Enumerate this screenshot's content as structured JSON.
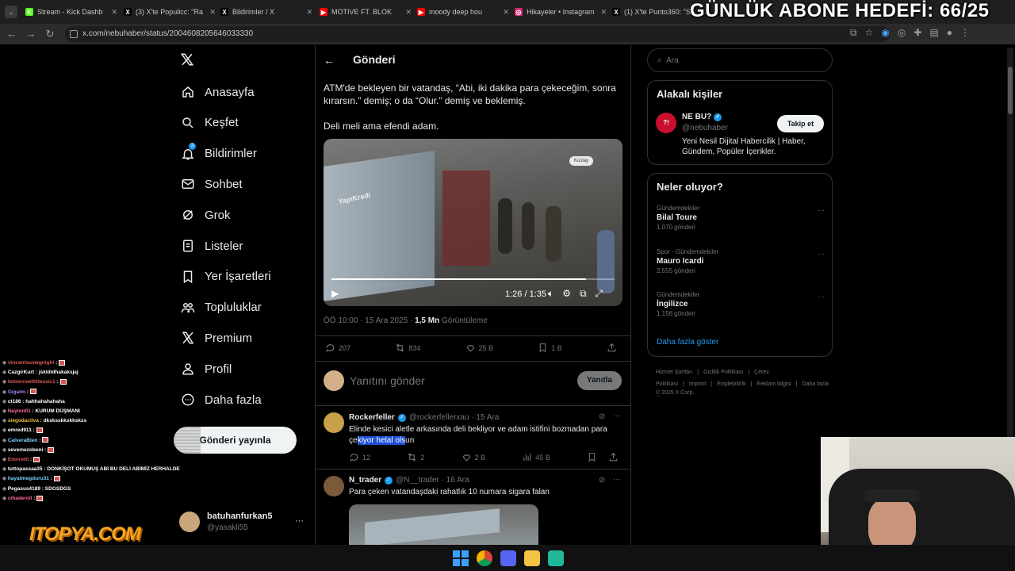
{
  "browser": {
    "tabs": [
      {
        "label": "Stream - Kick Dashb",
        "color": "#53fc18",
        "glyph": "K"
      },
      {
        "label": "(3) X'te Populicc: \"Ra",
        "color": "#000",
        "glyph": "X"
      },
      {
        "label": "Bildirimler / X",
        "color": "#000",
        "glyph": "X"
      },
      {
        "label": "MOTIVE FT. BLOK",
        "color": "#ff0000",
        "glyph": "▶"
      },
      {
        "label": "moody deep hou",
        "color": "#ff0000",
        "glyph": "▶"
      },
      {
        "label": "Hikayeler • Instagram",
        "color": "#d62976",
        "glyph": "◎"
      },
      {
        "label": "(1) X'te Punto360: \"S",
        "color": "#000",
        "glyph": "X"
      }
    ],
    "url": "x.com/nebuhaber/status/2004608205646033330"
  },
  "overlay": {
    "goal": "GÜNLÜK ABONE HEDEFİ: 66/25",
    "watermark": "ITOPYA.COM"
  },
  "nav": {
    "items": [
      {
        "label": "Anasayfa",
        "icon": "home-icon"
      },
      {
        "label": "Keşfet",
        "icon": "search-icon"
      },
      {
        "label": "Bildirimler",
        "icon": "bell-icon",
        "badge": "3"
      },
      {
        "label": "Sohbet",
        "icon": "mail-icon"
      },
      {
        "label": "Grok",
        "icon": "grok-icon"
      },
      {
        "label": "Listeler",
        "icon": "list-icon"
      },
      {
        "label": "Yer İşaretleri",
        "icon": "bookmark-icon"
      },
      {
        "label": "Topluluklar",
        "icon": "communities-icon"
      },
      {
        "label": "Premium",
        "icon": "x-logo-icon"
      },
      {
        "label": "Profil",
        "icon": "profile-icon"
      },
      {
        "label": "Daha fazla",
        "icon": "more-circle-icon"
      }
    ],
    "post_button": "Gönderi yayınla",
    "account_name": "batuhanfurkan5",
    "account_handle": "@yasakli55"
  },
  "post": {
    "header": "Gönderi",
    "text1": "ATM'de bekleyen bir vatandaş, “Abi, iki dakika para çekeceğim, sonra kırarsın.” demiş; o da “Olur.” demiş ve beklemiş.",
    "text2": "Deli meli ama efendi adam.",
    "video_time": "1:26 / 1:35",
    "video_progress": 0.9,
    "meta_time": "ÖÖ 10:00 · 15 Ara 2025 · ",
    "views": "1,5 Mn",
    "views_label": "Görüntüleme",
    "stats": {
      "replies": "207",
      "reposts": "834",
      "likes": "25 B",
      "bookmarks": "1 B"
    },
    "reply_placeholder": "Yanıtını gönder",
    "reply_button": "Yanıtla"
  },
  "replies": [
    {
      "name": "Rockerfeller",
      "handle": "@rockerfellerxau · 15 Ara",
      "text_before": "Elinde kesici aletle arkasında deli bekliyor ve adam istifini bozmadan para çe",
      "text_selected": "kiyor helal ols",
      "text_after": "un",
      "replies": "12",
      "reposts": "2",
      "likes": "2 B",
      "views": "45 B"
    },
    {
      "name": "N_trader",
      "handle": "@N__trader · 16 Ara",
      "text": "Para çeken vatandaşdaki rahatlık 10 numara sigara falan"
    }
  ],
  "search": {
    "placeholder": "Ara"
  },
  "related": {
    "title": "Alakalı kişiler",
    "name": "NE BU?",
    "handle": "@nebuhaber",
    "follow": "Takip et",
    "bio": "Yeni Nesil Dijital Habercilik | Haber, Gündem, Popüler İçerikler."
  },
  "trends": {
    "title": "Neler oluyor?",
    "items": [
      {
        "category": "Gündemdekiler",
        "name": "Bilal Toure",
        "count": "1.070 gönderi"
      },
      {
        "category": "Spor · Gündemdekiler",
        "name": "Mauro Icardi",
        "count": "2.555 gönderi"
      },
      {
        "category": "Gündemdekiler",
        "name": "İngilizce",
        "count": "1.156 gönderi"
      }
    ],
    "more": "Daha fazla göster"
  },
  "footer": {
    "links": [
      "Hizmet Şartları",
      "|",
      "Gizlilik Politikası",
      "|",
      "Çerez Politikası",
      "|",
      "Imprint",
      "|",
      "Erişilebilirlik",
      "|",
      "Reklam bilgisi",
      "|",
      "Daha fazla ···"
    ],
    "copyright": "© 2025 X Corp."
  },
  "chat": [
    {
      "user": "vincentsuswgnighi",
      "msg": "",
      "color": "#e05a5a"
    },
    {
      "user": "CazgirKurt",
      "msg": "jskldldhakaksjaj",
      "color": "#ffffff"
    },
    {
      "user": "tomorrowthitessic1",
      "msg": "",
      "color": "#e05a5a"
    },
    {
      "user": "Gigalm",
      "msg": "",
      "color": "#b07cff"
    },
    {
      "user": "ct186",
      "msg": "hahhahahahaha",
      "color": "#ffffff"
    },
    {
      "user": "Naylon01",
      "msg": "KURUM DÜŞMANI",
      "color": "#ff6b9a"
    },
    {
      "user": "siegodacilva",
      "msg": "dksksskkskkskss",
      "color": "#f0c040"
    },
    {
      "user": "emred911",
      "msg": "",
      "color": "#ffffff"
    },
    {
      "user": "CalveraBlen",
      "msg": "",
      "color": "#7dd3fc"
    },
    {
      "user": "sevemezobeni",
      "msg": "",
      "color": "#ffffff"
    },
    {
      "user": "Emoretti",
      "msg": "",
      "color": "#e05a5a"
    },
    {
      "user": "tuttopassaa35",
      "msg": "DONKİŞOT OKUMUŞ ABİ BU DELİ ABİMİZ HERHALDE",
      "color": "#ffffff"
    },
    {
      "user": "hayatmegduru31",
      "msg": "",
      "color": "#7dd3fc"
    },
    {
      "user": "Pegasus4189",
      "msg": "SDGSDGS",
      "color": "#ffffff"
    },
    {
      "user": "cihaderoll",
      "msg": "",
      "color": "#ff6b9a"
    }
  ],
  "colors": {
    "accent": "#1d9bf0",
    "bg": "#000000",
    "border": "#2f3336"
  }
}
